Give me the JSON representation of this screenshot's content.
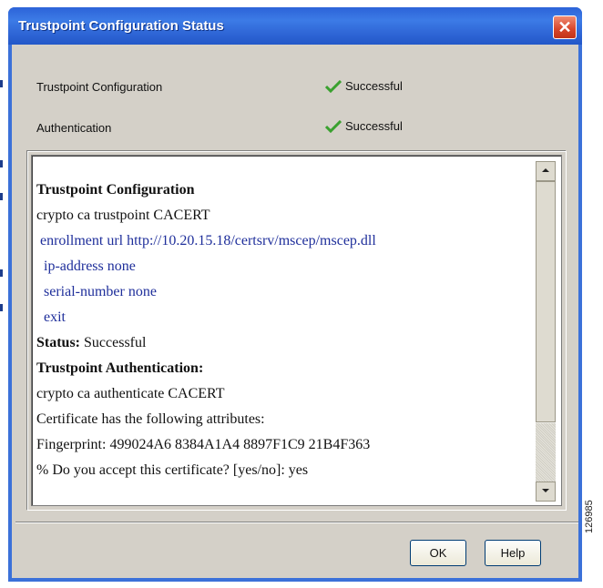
{
  "window": {
    "title": "Trustpoint Configuration Status",
    "close_glyph": "✕"
  },
  "summary": [
    {
      "label": "Trustpoint Configuration",
      "status": "Successful"
    },
    {
      "label": "Authentication",
      "status": "Successful"
    }
  ],
  "log": {
    "lines": [
      "Trustpoint Configuration",
      "crypto ca trustpoint CACERT",
      " enrollment url http://10.20.15.18/certsrv/mscep/mscep.dll",
      "  ip-address none",
      "  serial-number none",
      "  exit",
      "Status:",
      " Successful",
      "Trustpoint Authentication:",
      "crypto ca authenticate CACERT",
      "Certificate has the following attributes:",
      "Fingerprint: 499024A6 8384A1A4 8897F1C9 21B4F363",
      "% Do you accept this certificate? [yes/no]: yes"
    ]
  },
  "buttons": {
    "ok": "OK",
    "help": "Help"
  },
  "figure_id": "126985",
  "colors": {
    "title_bar": "#2c63d8",
    "client_bg": "#d4d0c8",
    "log_blue": "#1f2f9b",
    "check_green": "#3aa12f",
    "close_red": "#d7452a"
  }
}
